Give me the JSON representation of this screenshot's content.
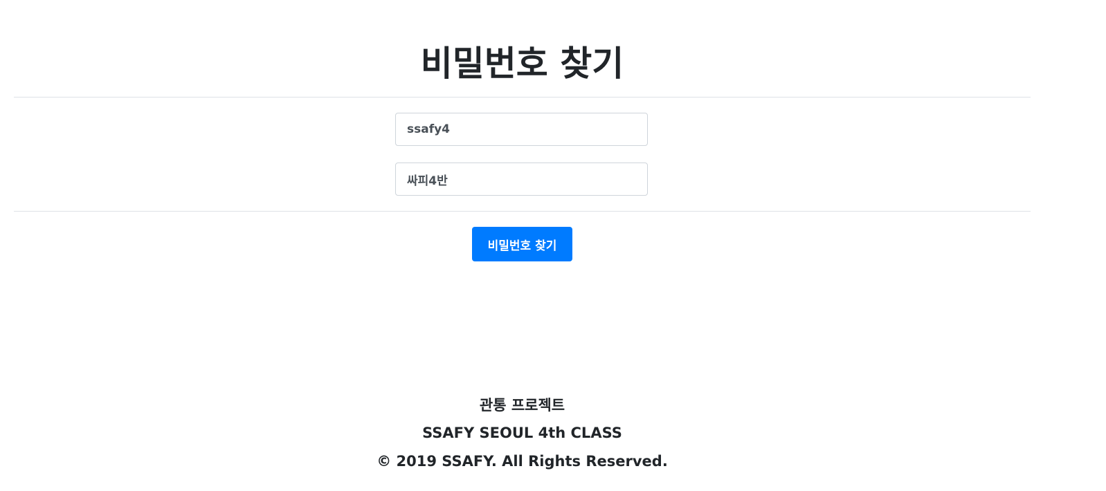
{
  "title": "비밀번호 찾기",
  "form": {
    "id_value": "ssafy4",
    "name_value": "싸피4반",
    "submit_label": "비밀번호 찾기"
  },
  "footer": {
    "project": "관통 프로젝트",
    "class": "SSAFY SEOUL 4th CLASS",
    "copyright": "© 2019 SSAFY. All Rights Reserved."
  }
}
